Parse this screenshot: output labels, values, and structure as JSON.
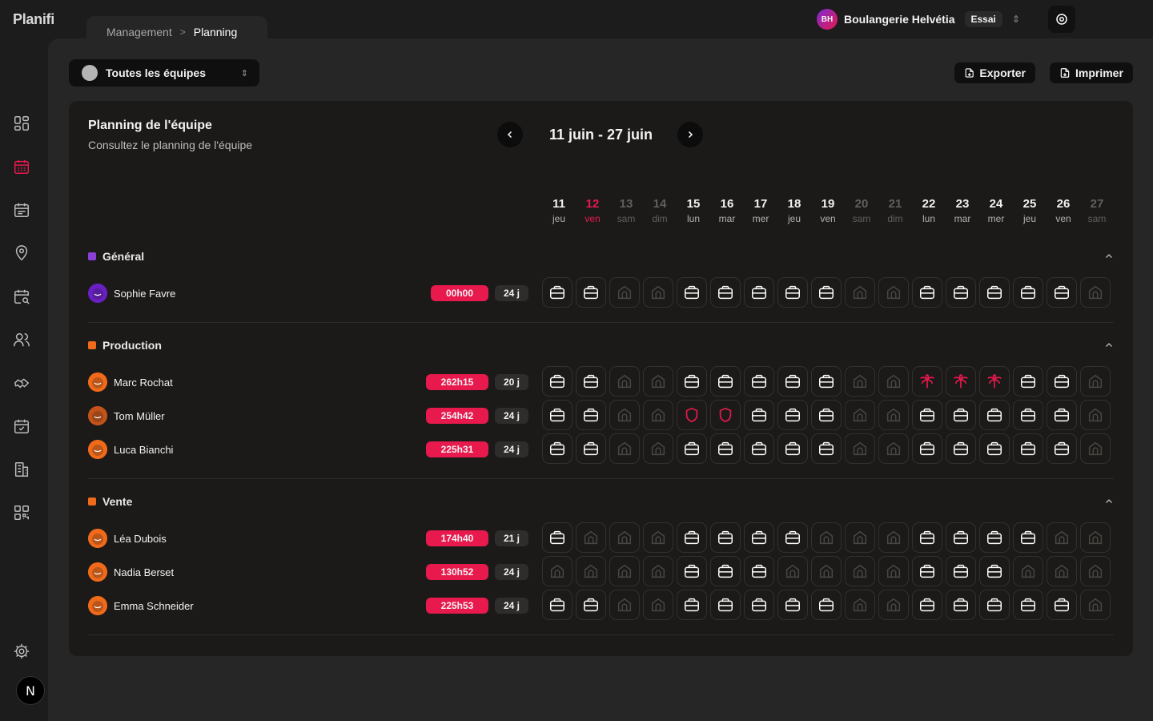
{
  "app": {
    "logo": "Planifi"
  },
  "breadcrumb": {
    "parent": "Management",
    "separator": ">",
    "current": "Planning"
  },
  "account": {
    "initials": "BH",
    "name": "Boulangerie Helvétia",
    "badge": "Essai",
    "switch": "⇕"
  },
  "sidebar": {
    "items": [
      "dashboard-icon",
      "calendar-icon",
      "schedule-icon",
      "location-icon",
      "calendar-search-icon",
      "users-icon",
      "handshake-icon",
      "calendar-check-icon",
      "building-icon",
      "qr-code-icon"
    ],
    "bottom": [
      "settings-icon"
    ],
    "badge": "N"
  },
  "toolbar": {
    "team_select": "Toutes les équipes",
    "team_select_switch": "⇕",
    "export_label": "Exporter",
    "print_label": "Imprimer"
  },
  "planning": {
    "title": "Planning de l'équipe",
    "subtitle": "Consultez le planning de l'équipe",
    "range": "11 juin - 27 juin",
    "days": [
      {
        "num": "11",
        "name": "jeu",
        "type": "normal"
      },
      {
        "num": "12",
        "name": "ven",
        "type": "today"
      },
      {
        "num": "13",
        "name": "sam",
        "type": "weekend"
      },
      {
        "num": "14",
        "name": "dim",
        "type": "weekend"
      },
      {
        "num": "15",
        "name": "lun",
        "type": "normal"
      },
      {
        "num": "16",
        "name": "mar",
        "type": "normal"
      },
      {
        "num": "17",
        "name": "mer",
        "type": "normal"
      },
      {
        "num": "18",
        "name": "jeu",
        "type": "normal"
      },
      {
        "num": "19",
        "name": "ven",
        "type": "normal"
      },
      {
        "num": "20",
        "name": "sam",
        "type": "weekend"
      },
      {
        "num": "21",
        "name": "dim",
        "type": "weekend"
      },
      {
        "num": "22",
        "name": "lun",
        "type": "normal"
      },
      {
        "num": "23",
        "name": "mar",
        "type": "normal"
      },
      {
        "num": "24",
        "name": "mer",
        "type": "normal"
      },
      {
        "num": "25",
        "name": "jeu",
        "type": "normal"
      },
      {
        "num": "26",
        "name": "ven",
        "type": "normal"
      },
      {
        "num": "27",
        "name": "sam",
        "type": "weekend"
      }
    ],
    "groups": [
      {
        "name": "Général",
        "color": "#8b3fd9",
        "employees": [
          {
            "name": "Sophie Favre",
            "hours": "00h00",
            "days": "24 j",
            "avatar_color": "#6a1fc4",
            "cells": "WWHHWWWWWHHWWWWWH"
          }
        ]
      },
      {
        "name": "Production",
        "color": "#f06a1a",
        "employees": [
          {
            "name": "Marc Rochat",
            "hours": "262h15",
            "days": "20 j",
            "avatar_color": "#f06a1a",
            "cells": "WWHHWWWWWHHVVVWWH"
          },
          {
            "name": "Tom Müller",
            "hours": "254h42",
            "days": "24 j",
            "avatar_color": "#c4531a",
            "cells": "WWHHSSWWWHHWWWWWH"
          },
          {
            "name": "Luca Bianchi",
            "hours": "225h31",
            "days": "24 j",
            "avatar_color": "#f06a1a",
            "cells": "WWHHWWWWWHHWWWWWH"
          }
        ]
      },
      {
        "name": "Vente",
        "color": "#f06a1a",
        "employees": [
          {
            "name": "Léa Dubois",
            "hours": "174h40",
            "days": "21 j",
            "avatar_color": "#f06a1a",
            "cells": "WHHHWWWWHHHWWWWHH"
          },
          {
            "name": "Nadia Berset",
            "hours": "130h52",
            "days": "24 j",
            "avatar_color": "#f06a1a",
            "cells": "HHHHWWWHHHHWWWHHH"
          },
          {
            "name": "Emma Schneider",
            "hours": "225h53",
            "days": "24 j",
            "avatar_color": "#f06a1a",
            "cells": "WWHHWWWWWHHWWWWWH"
          }
        ]
      }
    ],
    "cell_legend": {
      "W": "work-briefcase-icon",
      "H": "home-off-icon",
      "V": "vacation-palm-icon",
      "S": "sick-shield-icon"
    }
  },
  "colors": {
    "accent": "#e8194d",
    "background": "#1c1c1c",
    "panel": "#262626",
    "card": "#1c1a19"
  }
}
